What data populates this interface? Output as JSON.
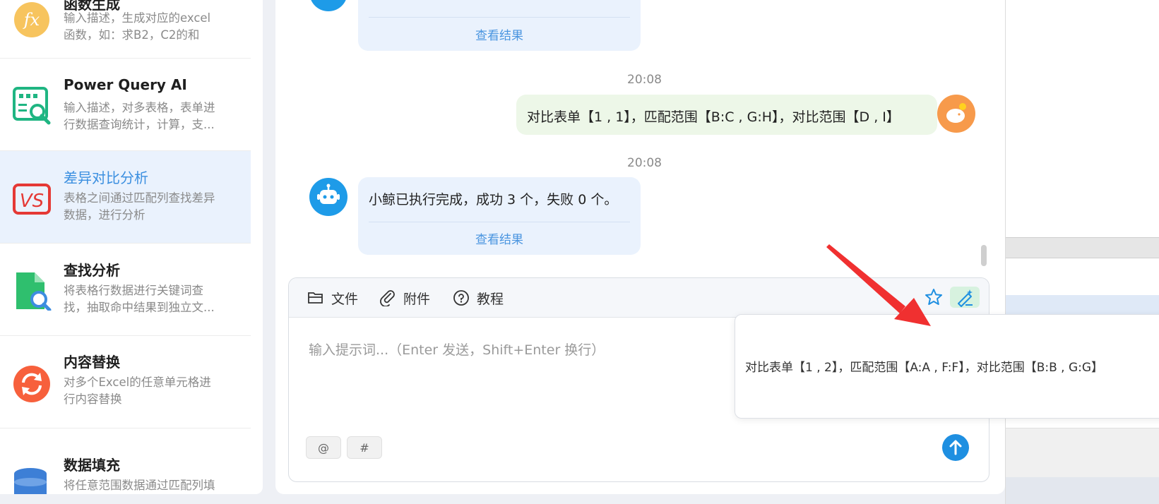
{
  "sidebar": {
    "items": [
      {
        "title": "函数生成",
        "desc": [
          "输入描述，生成对应的excel",
          "函数，如：求B2，C2的和"
        ],
        "icon": "fx-icon",
        "active": false
      },
      {
        "title": "Power Query AI",
        "desc": [
          "输入描述，对多表格，表单进",
          "行数据查询统计，计算，支..."
        ],
        "icon": "table-search-icon",
        "active": false
      },
      {
        "title": "差异对比分析",
        "desc": [
          "表格之间通过匹配列查找差异",
          "数据，进行分析"
        ],
        "icon": "vs-icon",
        "active": true
      },
      {
        "title": "查找分析",
        "desc": [
          "将表格行数据进行关键词查",
          "找，抽取命中结果到独立文..."
        ],
        "icon": "file-search-icon",
        "active": false
      },
      {
        "title": "内容替换",
        "desc": [
          "对多个Excel的任意单元格进",
          "行内容替换"
        ],
        "icon": "replace-icon",
        "active": false
      },
      {
        "title": "数据填充",
        "desc": [
          "将任意范围数据通过匹配列填",
          ""
        ],
        "icon": "database-icon",
        "active": false
      }
    ]
  },
  "chat": {
    "messages": [
      {
        "role": "bot",
        "text": "",
        "link": "查看结果"
      },
      {
        "role": "time",
        "text": "20:08"
      },
      {
        "role": "user",
        "text": "对比表单【1 , 1】，匹配范围【B:C , G:H】，对比范围【D , I】"
      },
      {
        "role": "time",
        "text": "20:08"
      },
      {
        "role": "bot",
        "text": "小鲸已执行完成，成功 3 个，失败 0 个。",
        "link": "查看结果"
      }
    ]
  },
  "toolbar": {
    "file_label": "文件",
    "attach_label": "附件",
    "tutorial_label": "教程"
  },
  "input": {
    "placeholder": "输入提示词...（Enter 发送，Shift+Enter 换行）",
    "chip_at": "@",
    "chip_hash": "#"
  },
  "popup": {
    "suggestion": "对比表单【1 , 2】，匹配范围【A:A , F:F】，对比范围【B:B , G:G】"
  },
  "colors": {
    "accent": "#1e8fe1",
    "active_bg": "#eaf2fd",
    "user_bubble": "#edf7e8",
    "annotation_arrow": "#f03030"
  }
}
